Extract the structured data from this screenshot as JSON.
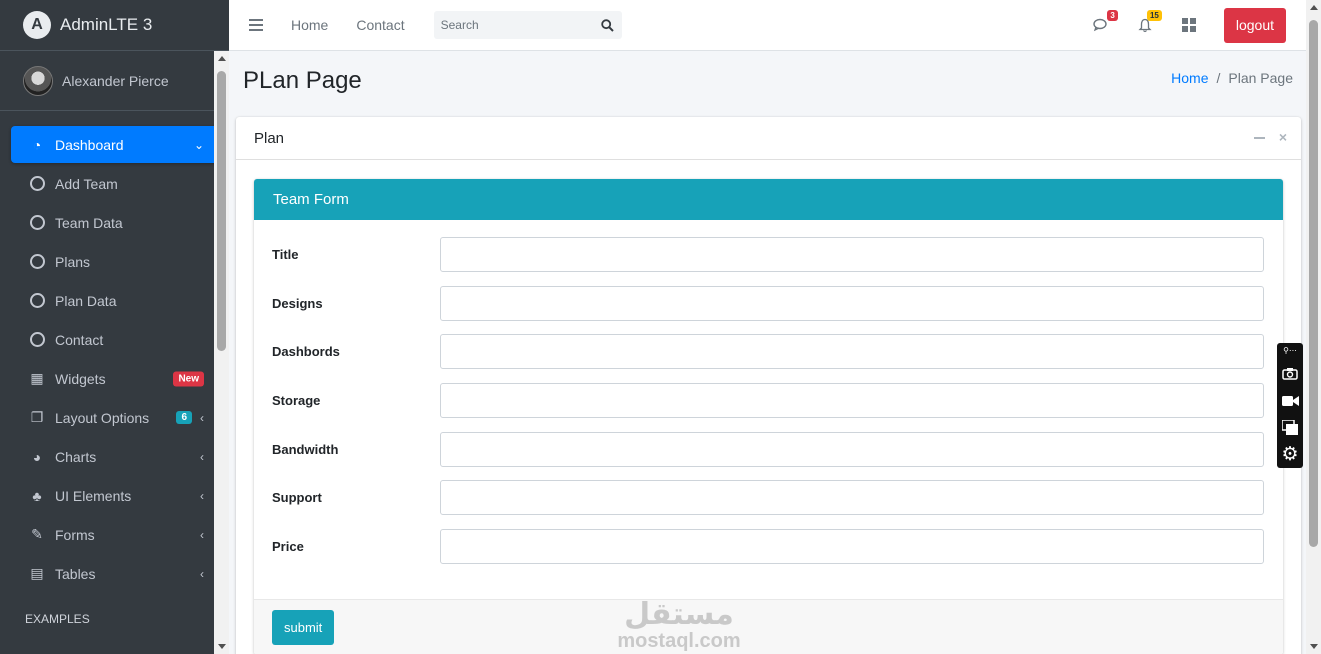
{
  "brand": {
    "title": "AdminLTE 3",
    "logo_letter": "A"
  },
  "user": {
    "name": "Alexander Pierce"
  },
  "sidebar": {
    "items": [
      {
        "label": "Dashboard",
        "icon": "tachometer-icon",
        "glyph": "◔",
        "active": true
      },
      {
        "label": "Add Team",
        "icon": "circle-icon"
      },
      {
        "label": "Team Data",
        "icon": "circle-icon"
      },
      {
        "label": "Plans",
        "icon": "circle-icon"
      },
      {
        "label": "Plan Data",
        "icon": "circle-icon"
      },
      {
        "label": "Contact",
        "icon": "circle-icon"
      },
      {
        "label": "Widgets",
        "icon": "grid-icon",
        "glyph": "▦",
        "badge": "New"
      },
      {
        "label": "Layout Options",
        "icon": "copy-icon",
        "glyph": "❐",
        "badge": "6"
      },
      {
        "label": "Charts",
        "icon": "pie-chart-icon",
        "glyph": "◕"
      },
      {
        "label": "UI Elements",
        "icon": "tree-icon",
        "glyph": "♣"
      },
      {
        "label": "Forms",
        "icon": "edit-icon",
        "glyph": "✎"
      },
      {
        "label": "Tables",
        "icon": "table-icon",
        "glyph": "▤"
      }
    ],
    "section_header": "EXAMPLES"
  },
  "navbar": {
    "home": "Home",
    "contact": "Contact",
    "search_placeholder": "Search",
    "messages_count": "3",
    "notifications_count": "15",
    "logout_label": "logout"
  },
  "page": {
    "title": "PLan Page",
    "breadcrumb": {
      "home": "Home",
      "separator": "/",
      "current": "Plan Page"
    }
  },
  "card": {
    "title": "Plan",
    "form_title": "Team Form",
    "fields": [
      {
        "label": "Title",
        "value": ""
      },
      {
        "label": "Designs",
        "value": ""
      },
      {
        "label": "Dashbords",
        "value": ""
      },
      {
        "label": "Storage",
        "value": ""
      },
      {
        "label": "Bandwidth",
        "value": ""
      },
      {
        "label": "Support",
        "value": ""
      },
      {
        "label": "Price",
        "value": ""
      }
    ],
    "submit_label": "submit"
  },
  "watermark": {
    "arabic": "مستقل",
    "latin": "mostaql.com"
  },
  "colors": {
    "primary": "#007bff",
    "info": "#17a2b8",
    "danger": "#dc3545",
    "warning": "#ffc107",
    "sidebar": "#343a40"
  }
}
